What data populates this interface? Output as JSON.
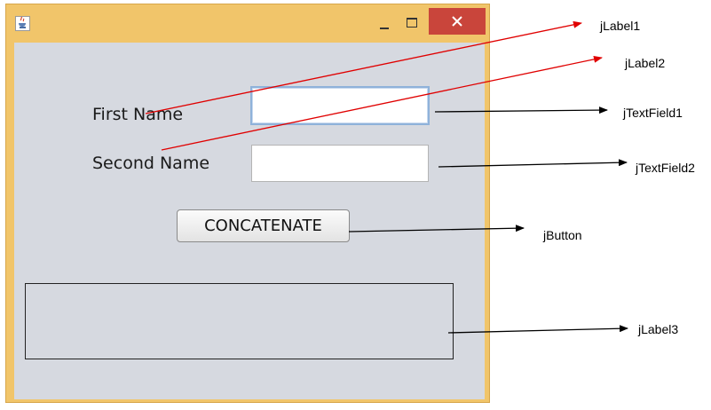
{
  "form": {
    "first_name_label": "First Name",
    "second_name_label": "Second Name",
    "first_name_value": "",
    "second_name_value": "",
    "button_label": "CONCATENATE",
    "output_text": ""
  },
  "annotations": {
    "label1": "jLabel1",
    "label2": "jLabel2",
    "textfield1": "jTextField1",
    "textfield2": "jTextField2",
    "button": "jButton",
    "label3": "jLabel3"
  },
  "colors": {
    "window_frame": "#f1c56a",
    "close_button": "#c9453b",
    "client_area": "#d6d9e0",
    "annotation_red": "#e00000",
    "annotation_black": "#000000"
  }
}
